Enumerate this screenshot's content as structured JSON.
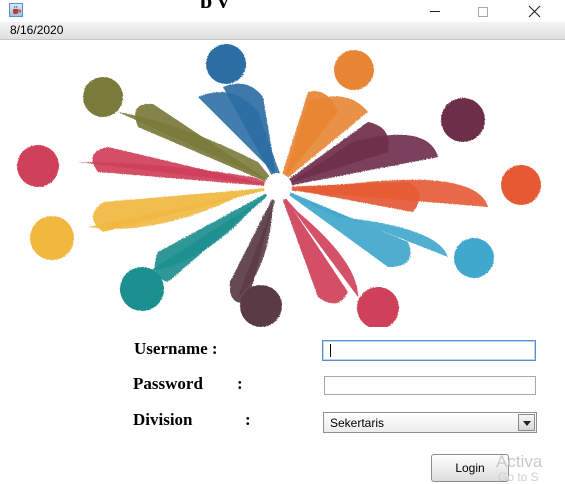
{
  "window": {
    "title_clipped": "p      y",
    "app_icon": "java-coffee-icon",
    "controls": [
      "minimize-icon",
      "maximize-icon",
      "close-icon"
    ]
  },
  "status": {
    "date": "8/16/2020"
  },
  "logo": {
    "icon": "people-circle-logo"
  },
  "form": {
    "username_label": "Username :",
    "password_label": "Password",
    "division_label": "Division",
    "colon": ":",
    "username_value": "",
    "password_value": "",
    "division_selected": "Sekertaris",
    "login_label": "Login"
  },
  "watermark": {
    "line1": "Activa",
    "line2": "Go to S"
  },
  "colors": {
    "accent_focus": "#5b8fc9",
    "statusbar": "#e6e6e6"
  }
}
